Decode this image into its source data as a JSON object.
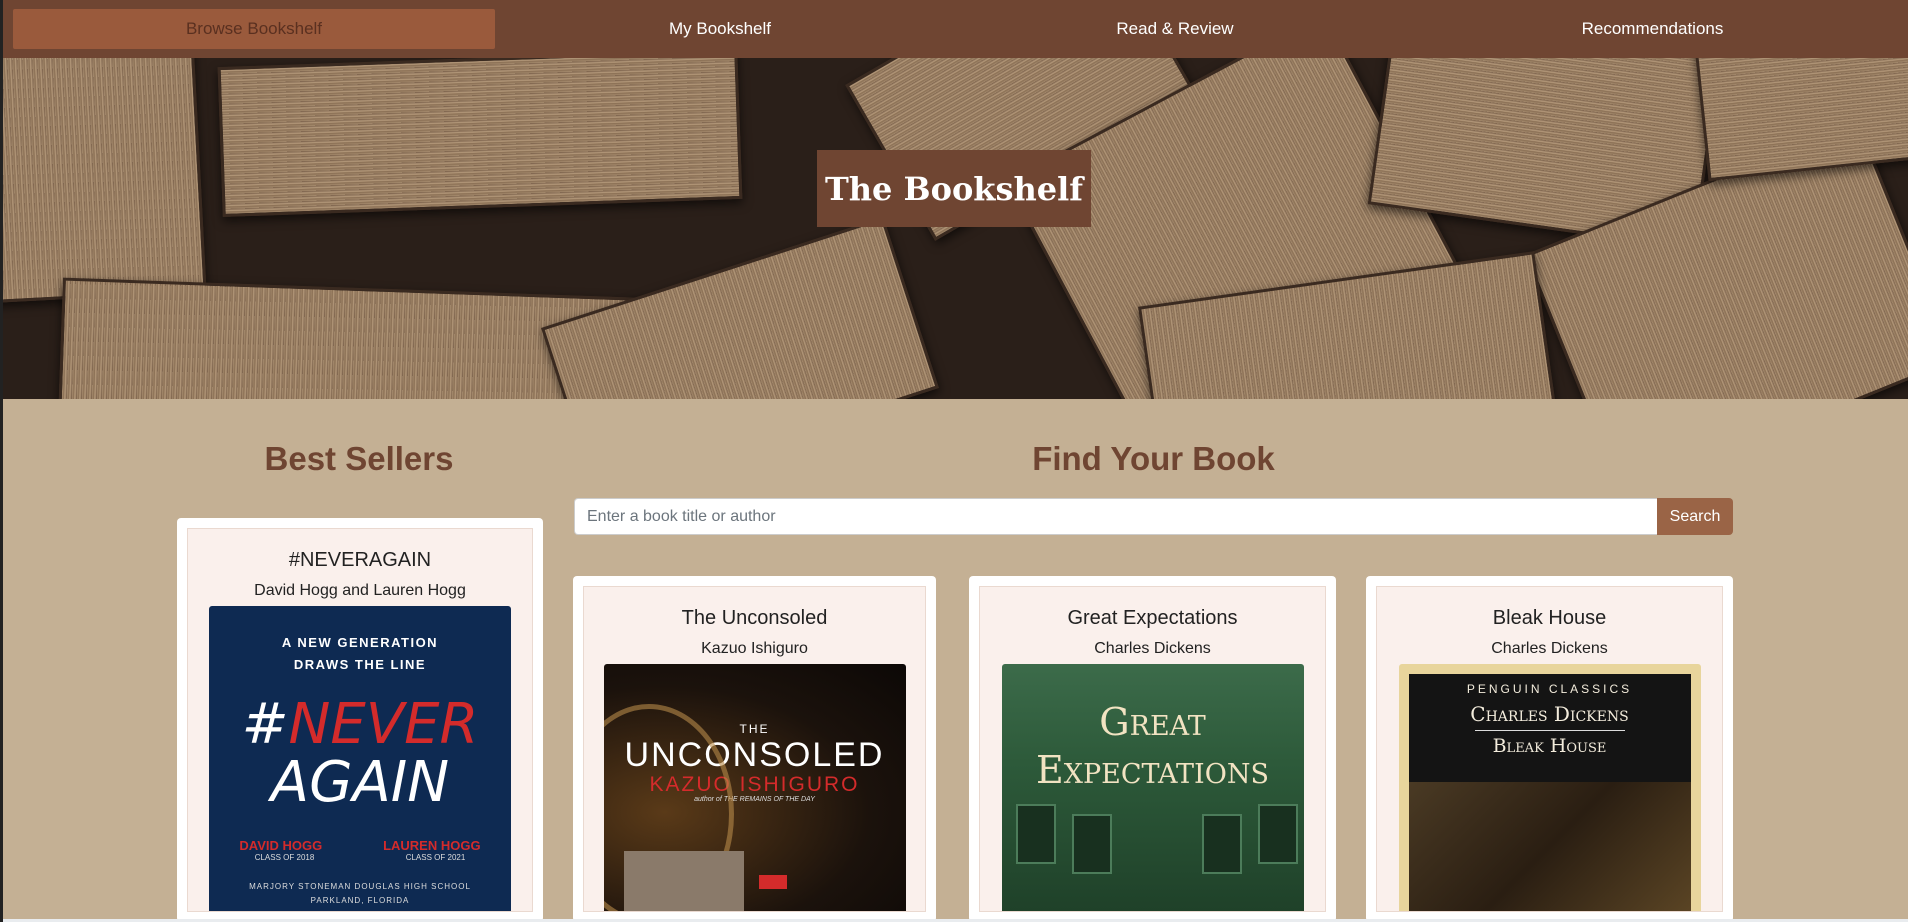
{
  "nav": {
    "items": [
      {
        "label": "Browse Bookshelf",
        "active": true
      },
      {
        "label": "My Bookshelf",
        "active": false
      },
      {
        "label": "Read & Review",
        "active": false
      },
      {
        "label": "Recommendations",
        "active": false
      }
    ]
  },
  "hero": {
    "title": "The Bookshelf"
  },
  "best_sellers": {
    "heading": "Best Sellers",
    "book": {
      "title": "#NEVERAGAIN",
      "author": "David Hogg and Lauren Hogg",
      "cover": {
        "tag_line_1": "A NEW GENERATION",
        "tag_line_2": "DRAWS THE LINE",
        "hash": "#",
        "never": "NEVER",
        "again": "AGAIN",
        "name_1": "DAVID HOGG",
        "name_2": "LAUREN HOGG",
        "class_1": "CLASS OF 2018",
        "class_2": "CLASS OF 2021",
        "school_1": "MARJORY STONEMAN DOUGLAS HIGH SCHOOL",
        "school_2": "PARKLAND, FLORIDA"
      }
    }
  },
  "search": {
    "heading": "Find Your Book",
    "placeholder": "Enter a book title or author",
    "button_label": "Search"
  },
  "results": [
    {
      "title": "The Unconsoled",
      "author": "Kazuo Ishiguro",
      "cover": {
        "the": "THE",
        "title": "UNCONSOLED",
        "author": "KAZUO ISHIGURO",
        "small": "author of THE REMAINS OF THE DAY"
      }
    },
    {
      "title": "Great Expectations",
      "author": "Charles Dickens",
      "cover": {
        "line_1": "Great",
        "line_2": "Expectations"
      }
    },
    {
      "title": "Bleak House",
      "author": "Charles Dickens",
      "cover": {
        "imprint": "PENGUIN CLASSICS",
        "author": "Charles Dickens",
        "title": "Bleak House"
      }
    }
  ],
  "colors": {
    "nav_bg": "#6f4532",
    "page_bg": "#c4b094",
    "accent": "#9a6446",
    "heading": "#6f4532"
  }
}
